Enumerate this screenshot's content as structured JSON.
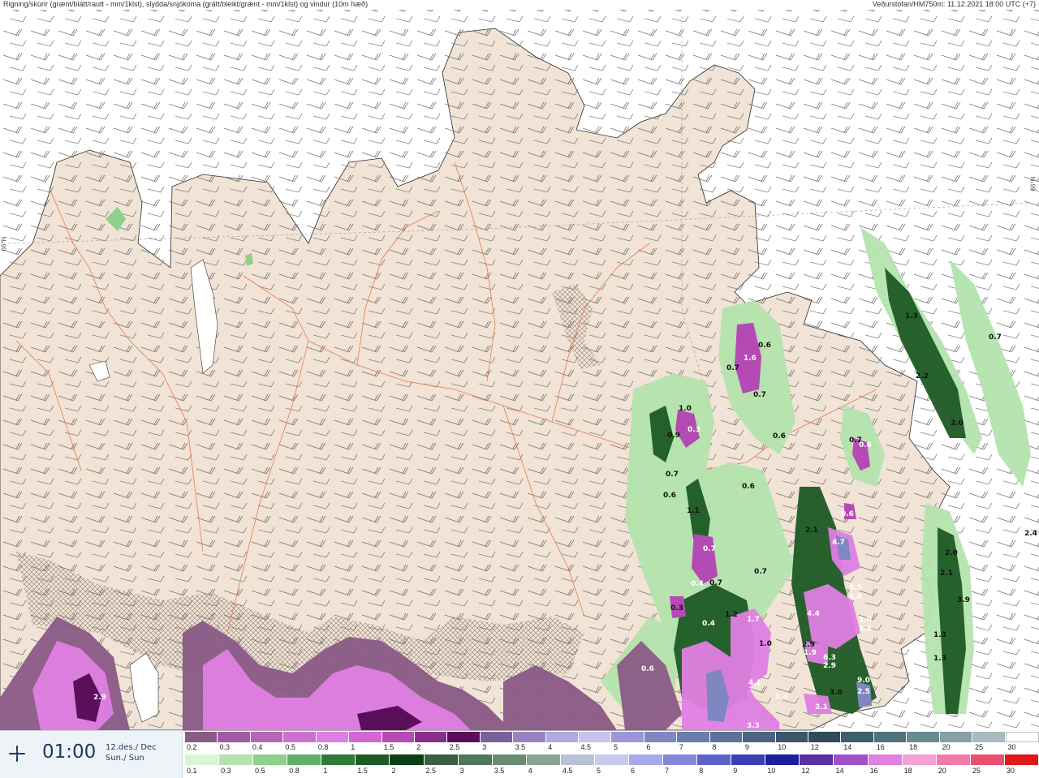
{
  "header": {
    "left_title": "Rigning/skúrir (grænt/blátt/rautt - mm/1klst), slydda/snjókoma (grátt/bleikt/grænt - mm/1klst) og vindur (10m hæð)",
    "right_title": "Veðurstofan/HM750m: 11.12.2021 18:00 UTC (+7)",
    "lat_label": "66°N"
  },
  "timebox": {
    "icon": "forecast-time-icon",
    "time": "01:00",
    "date_line1": "12.des./ Dec",
    "date_line2": "Sun./ Sun"
  },
  "legend_snow": {
    "labels": [
      "0.2",
      "0.3",
      "0.4",
      "0.5",
      "0.8",
      "1",
      "1.5",
      "2",
      "2.5",
      "3",
      "3.5",
      "4",
      "4.5",
      "5",
      "6",
      "7",
      "8",
      "9",
      "10",
      "12",
      "14",
      "16",
      "18",
      "20",
      "25",
      "30"
    ],
    "colors": [
      "#8a5a86",
      "#a35aa6",
      "#b864b9",
      "#cc6fcf",
      "#e07fe3",
      "#d466d6",
      "#b44ab4",
      "#8b2d8c",
      "#5a0f5b",
      "#7a5f9a",
      "#9a82c0",
      "#b4a8e0",
      "#c8c4f0",
      "#9b96d6",
      "#7f87c0",
      "#6a7cab",
      "#5c7299",
      "#4b6381",
      "#3b5569",
      "#2f4c5c",
      "#3d5e6a",
      "#51727c",
      "#6a8a92",
      "#86a0a6",
      "#a8bcbf",
      "#ffffff"
    ]
  },
  "legend_rain": {
    "labels": [
      "0.1",
      "0.3",
      "0.5",
      "0.8",
      "1",
      "1.5",
      "2",
      "2.5",
      "3",
      "3.5",
      "4",
      "4.5",
      "5",
      "6",
      "7",
      "8",
      "9",
      "10",
      "12",
      "14",
      "16",
      "18",
      "20",
      "25",
      "30"
    ],
    "colors": [
      "#d8f5d4",
      "#b4e4ae",
      "#8fd08a",
      "#62b066",
      "#2f7a36",
      "#1d5a25",
      "#0c3f15",
      "#3a5f42",
      "#4f7759",
      "#6a8c73",
      "#8aa492",
      "#b9c1d8",
      "#c8caf0",
      "#a7a9ea",
      "#8388dd",
      "#5d62c8",
      "#3a3fb4",
      "#1a1fa0",
      "#5a2fa0",
      "#a050c8",
      "#e080e0",
      "#f4a0d4",
      "#f07aa8",
      "#e8506e",
      "#e01818"
    ]
  },
  "map_labels": [
    "1.6",
    "0.6",
    "0.7",
    "1.0",
    "0.3",
    "0.9",
    "0.7",
    "0.6",
    "0.6",
    "0.6",
    "1.1",
    "0.7",
    "0.4",
    "0.7",
    "0.3",
    "0.7",
    "0.4",
    "1.2",
    "1.7",
    "1.0",
    "0.6",
    "4.1",
    "1.4",
    "3.3",
    "0.7",
    "0.6",
    "0.7",
    "2.1",
    "4.7",
    "5.5",
    "3.8",
    "4.4",
    "1.0",
    "3.8",
    "2.9",
    "1.9",
    "6.3",
    "2.9",
    "9.0",
    "2.5",
    "3.0",
    "2.1",
    "1.3",
    "2.2",
    "2.0",
    "0.7",
    "2.0",
    "2.1",
    "3.9",
    "1.3",
    "1.3",
    "2.4",
    "2.9",
    "0.6"
  ]
}
